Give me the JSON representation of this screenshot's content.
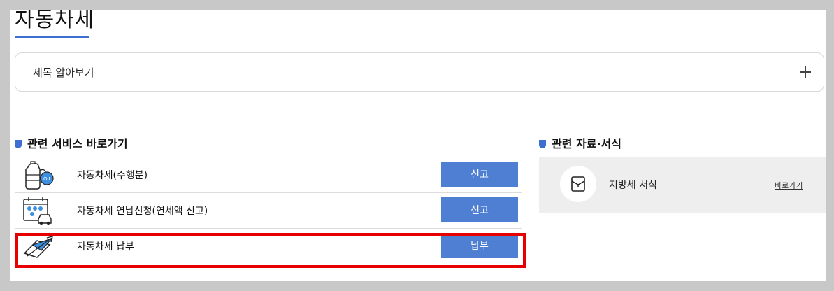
{
  "page": {
    "title": "자동차세"
  },
  "accordion": {
    "label": "세목 알아보기"
  },
  "services": {
    "title": "관련 서비스 바로가기",
    "items": [
      {
        "icon": "oil-tank-icon",
        "label": "자동차세(주행분)",
        "button": "신고"
      },
      {
        "icon": "calendar-car-icon",
        "label": "자동차세 연납신청(연세액 신고)",
        "button": "신고"
      },
      {
        "icon": "payment-card-icon",
        "label": "자동차세 납부",
        "button": "납부"
      }
    ]
  },
  "resources": {
    "title": "관련 자료·서식",
    "item": {
      "icon": "document-folder-icon",
      "label": "지방세 서식",
      "link": "바로가기"
    }
  },
  "colors": {
    "accent": "#3c6fd1",
    "button": "#4e7fd2",
    "highlight": "#e60000"
  }
}
